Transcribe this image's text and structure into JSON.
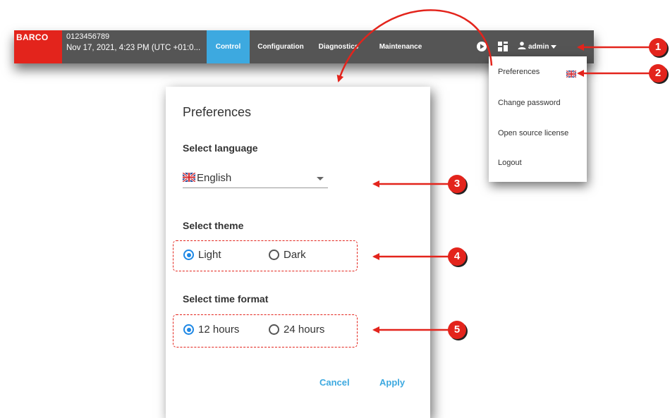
{
  "topbar": {
    "logo": "BARCO",
    "device_id": "0123456789",
    "datetime": "Nov 17, 2021, 4:23 PM (UTC +01:0...",
    "tabs": [
      {
        "label": "Control",
        "active": true
      },
      {
        "label": "Configuration",
        "active": false
      },
      {
        "label": "Diagnostics",
        "active": false
      },
      {
        "label": "Maintenance",
        "active": false
      }
    ],
    "icons": [
      "play-icon",
      "layout-icon"
    ],
    "user": "admin"
  },
  "user_menu": {
    "items": [
      "Preferences",
      "Change password",
      "Open source license",
      "Logout"
    ]
  },
  "preferences": {
    "title": "Preferences",
    "language_label": "Select language",
    "language_value": "English",
    "theme_label": "Select theme",
    "theme_options": [
      {
        "label": "Light",
        "selected": true
      },
      {
        "label": "Dark",
        "selected": false
      }
    ],
    "time_label": "Select time format",
    "time_options": [
      {
        "label": "12 hours",
        "selected": true
      },
      {
        "label": "24 hours",
        "selected": false
      }
    ],
    "cancel_label": "Cancel",
    "apply_label": "Apply"
  },
  "callouts": [
    "1",
    "2",
    "3",
    "4",
    "5"
  ],
  "colors": {
    "accent": "#3da9e0",
    "brand_red": "#e3241c",
    "topbar": "#555555",
    "radio_selected": "#1e88e5"
  }
}
